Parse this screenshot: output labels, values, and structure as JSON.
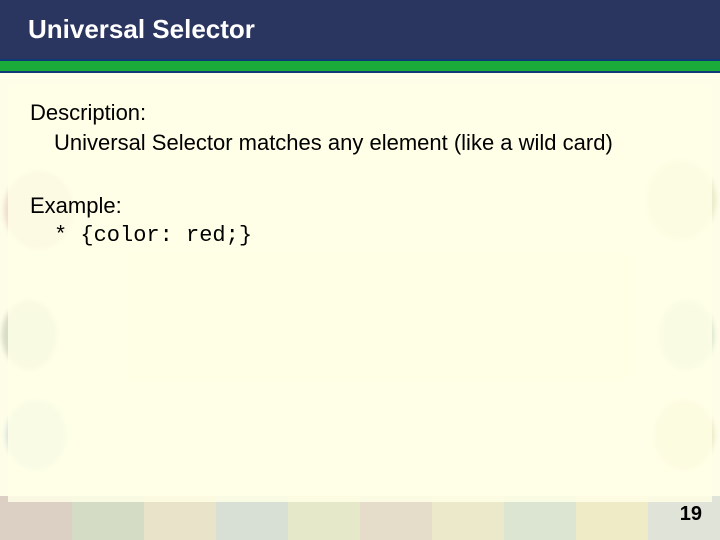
{
  "header": {
    "title": "Universal Selector"
  },
  "body": {
    "description_label": "Description:",
    "description_text": "Universal Selector matches any element (like a wild card)",
    "example_label": "Example:",
    "example_code": "* {color: red;}"
  },
  "footer": {
    "page_number": "19"
  },
  "colors": {
    "header_bg": "#2a3560",
    "green_bar": "#1aab3a",
    "page_bg": "#fdfde8"
  }
}
